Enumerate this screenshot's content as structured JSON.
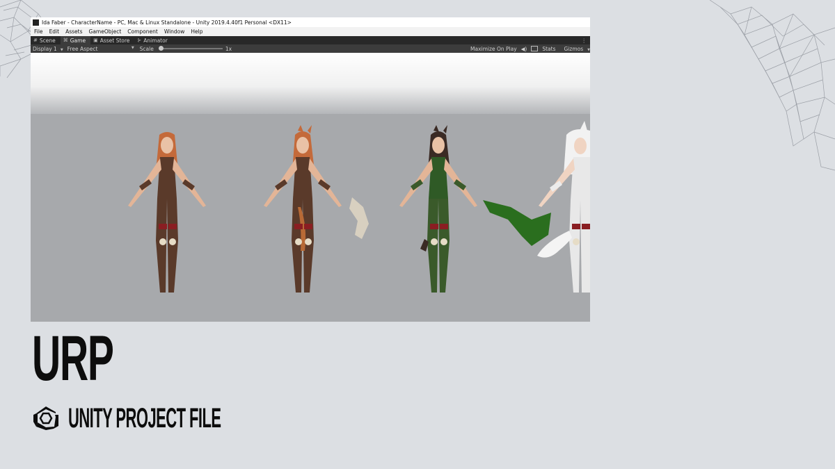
{
  "window": {
    "title": "Ida Faber - CharacterName - PC, Mac & Linux Standalone - Unity 2019.4.40f1 Personal <DX11>"
  },
  "menu": [
    "File",
    "Edit",
    "Assets",
    "GameObject",
    "Component",
    "Window",
    "Help"
  ],
  "tabs": [
    {
      "label": "Scene",
      "icon": "grid-icon"
    },
    {
      "label": "Game",
      "icon": "gamepad-icon"
    },
    {
      "label": "Asset Store",
      "icon": "bag-icon"
    },
    {
      "label": "Animator",
      "icon": "animator-icon"
    }
  ],
  "toolbar": {
    "display": "Display 1",
    "aspect": "Free Aspect",
    "scale_label": "Scale",
    "scale_value": "1x",
    "maximize": "Maximize On Play",
    "stats": "Stats",
    "gizmos": "Gizmos"
  },
  "slide": {
    "heading": "URP",
    "subtitle": "UNITY PROJECT FILE"
  },
  "colors": {
    "character_skin_brown": "#5a3a2a",
    "character_skin_green": "#3a5a2a",
    "character_skin_white": "#e8e8e8",
    "axe_green": "#2a6e1e"
  }
}
